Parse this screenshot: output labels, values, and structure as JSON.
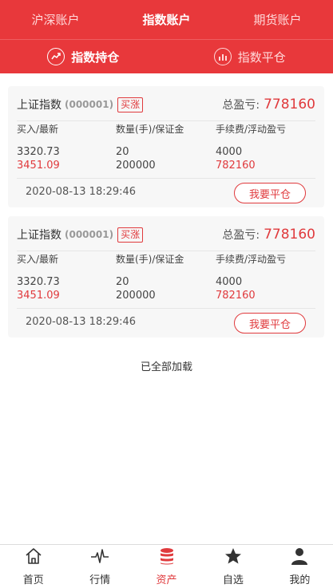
{
  "top_tabs": [
    {
      "label": "沪深账户"
    },
    {
      "label": "指数账户"
    },
    {
      "label": "期货账户"
    }
  ],
  "sub_tabs": [
    {
      "label": "指数持仓",
      "icon": "chart-up-icon"
    },
    {
      "label": "指数平仓",
      "icon": "bar-chart-icon"
    }
  ],
  "columns": {
    "col1": "买入/最新",
    "col2": "数量(手)/保证金",
    "col3": "手续费/浮动盈亏"
  },
  "positions": [
    {
      "name": "上证指数",
      "code": "(000001)",
      "tag": "买涨",
      "total_label": "总盈亏:",
      "total_value": "778160",
      "buy_price": "3320.73",
      "latest_price": "3451.09",
      "quantity": "20",
      "margin": "200000",
      "fee": "4000",
      "floating_pl": "782160",
      "time": "2020-08-13 18:29:46",
      "action": "我要平仓"
    },
    {
      "name": "上证指数",
      "code": "(000001)",
      "tag": "买涨",
      "total_label": "总盈亏:",
      "total_value": "778160",
      "buy_price": "3320.73",
      "latest_price": "3451.09",
      "quantity": "20",
      "margin": "200000",
      "fee": "4000",
      "floating_pl": "782160",
      "time": "2020-08-13 18:29:46",
      "action": "我要平仓"
    }
  ],
  "loaded_text": "已全部加载",
  "tabbar": [
    {
      "label": "首页",
      "icon": "home-icon"
    },
    {
      "label": "行情",
      "icon": "pulse-icon"
    },
    {
      "label": "资产",
      "icon": "coins-icon"
    },
    {
      "label": "自选",
      "icon": "star-icon"
    },
    {
      "label": "我的",
      "icon": "user-icon"
    }
  ],
  "colors": {
    "brand": "#e8383b",
    "accent_red": "#e03a3d"
  }
}
